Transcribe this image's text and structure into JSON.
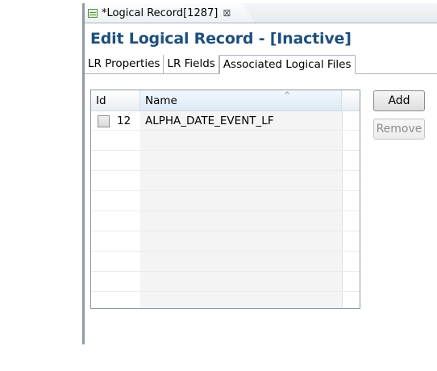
{
  "editor_tab": {
    "title": "*Logical Record[1287]",
    "close_glyph": "⊠"
  },
  "page": {
    "title": "Edit Logical Record - [Inactive]"
  },
  "subtabs": [
    {
      "label": "LR Properties",
      "active": false
    },
    {
      "label": "LR Fields",
      "active": false
    },
    {
      "label": "Associated Logical Files",
      "active": true
    }
  ],
  "table": {
    "columns": [
      "Id",
      "Name"
    ],
    "sorted_column": "Name",
    "rows": [
      {
        "checked": false,
        "id": "12",
        "name": "ALPHA_DATE_EVENT_LF"
      }
    ]
  },
  "buttons": {
    "add": "Add",
    "remove": "Remove",
    "remove_enabled": false
  },
  "colors": {
    "title": "#1d4f7c",
    "border": "#8b98a5"
  },
  "icons": {
    "editor_tab_icon": "table-icon",
    "sort_icon": "sort-asc-icon"
  }
}
